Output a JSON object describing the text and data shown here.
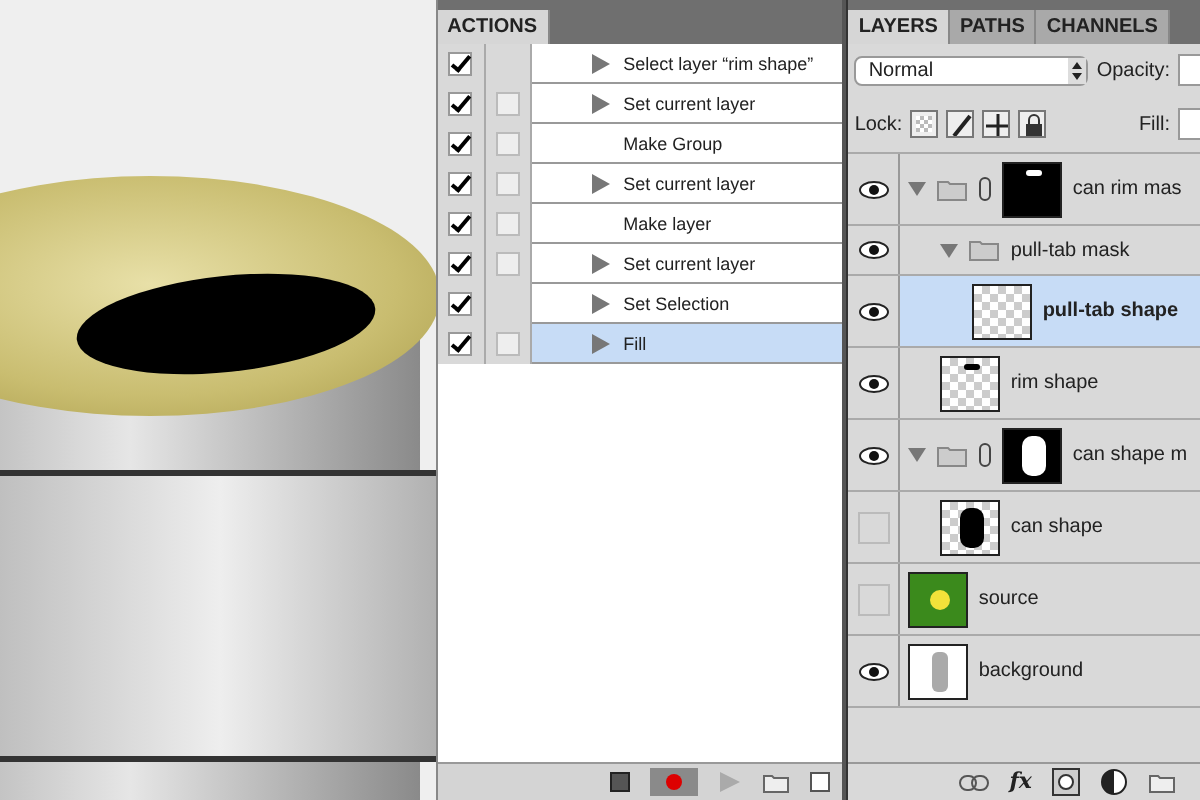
{
  "actions_panel": {
    "tabs": [
      {
        "label": "ACTIONS",
        "selected": true
      }
    ],
    "steps": [
      {
        "label": "Select layer “rim shape”",
        "checked": true,
        "dialog": false,
        "expandable": true,
        "selected": false
      },
      {
        "label": "Set current layer",
        "checked": true,
        "dialog": true,
        "expandable": true,
        "selected": false
      },
      {
        "label": "Make Group",
        "checked": true,
        "dialog": true,
        "expandable": false,
        "selected": false
      },
      {
        "label": "Set current layer",
        "checked": true,
        "dialog": true,
        "expandable": true,
        "selected": false
      },
      {
        "label": "Make layer",
        "checked": true,
        "dialog": true,
        "expandable": false,
        "selected": false
      },
      {
        "label": "Set current layer",
        "checked": true,
        "dialog": true,
        "expandable": true,
        "selected": false
      },
      {
        "label": "Set Selection",
        "checked": true,
        "dialog": false,
        "expandable": true,
        "selected": false
      },
      {
        "label": "Fill",
        "checked": true,
        "dialog": true,
        "expandable": true,
        "selected": true
      }
    ]
  },
  "layers_panel": {
    "tabs": [
      {
        "label": "LAYERS",
        "selected": true
      },
      {
        "label": "PATHS",
        "selected": false
      },
      {
        "label": "CHANNELS",
        "selected": false
      }
    ],
    "blend_mode": "Normal",
    "layer_style_label": "fx",
    "opacity_label": "Opacity:",
    "lock_label": "Lock:",
    "fill_label": "Fill:",
    "layers": [
      {
        "name": "can rim mas",
        "kind": "group",
        "visible": true,
        "expanded": true,
        "selected": false,
        "thumbnail": {
          "kind": "rim-mask"
        },
        "children": [
          {
            "name": "pull-tab mask",
            "kind": "group",
            "visible": true,
            "expanded": true,
            "selected": false,
            "children": [
              {
                "name": "pull-tab shape",
                "kind": "layer",
                "visible": true,
                "selected": true,
                "thumbnail": {
                  "kind": "transparent"
                }
              }
            ]
          },
          {
            "name": "rim shape",
            "kind": "layer",
            "visible": true,
            "selected": false,
            "thumbnail": {
              "kind": "rim"
            }
          }
        ]
      },
      {
        "name": "can shape m",
        "kind": "group",
        "visible": true,
        "expanded": true,
        "selected": false,
        "thumbnail": {
          "kind": "can-mask"
        },
        "children": [
          {
            "name": "can shape",
            "kind": "layer",
            "visible": false,
            "selected": false,
            "thumbnail": {
              "kind": "can"
            }
          }
        ]
      },
      {
        "name": "source",
        "kind": "layer",
        "visible": false,
        "selected": false,
        "thumbnail": {
          "kind": "source"
        }
      },
      {
        "name": "background",
        "kind": "layer",
        "visible": true,
        "selected": false,
        "thumbnail": {
          "kind": "background"
        }
      }
    ]
  }
}
